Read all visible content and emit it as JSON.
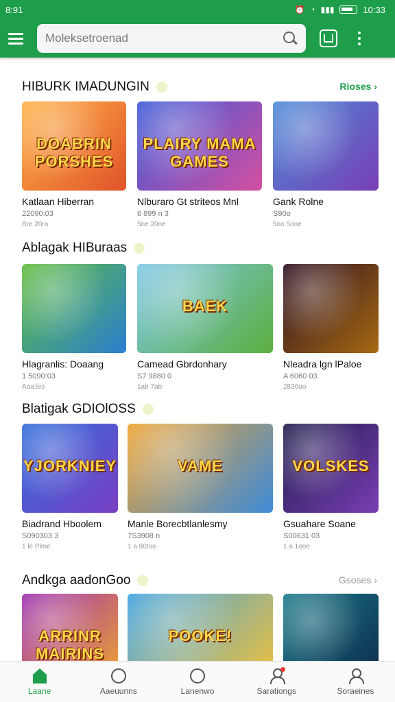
{
  "status_bar": {
    "time": "8:91",
    "right_time": "10:33"
  },
  "search": {
    "placeholder": "Moleksetroenad"
  },
  "sections": [
    {
      "title": "HIBURK IMADUNGIN",
      "more": "Rioses",
      "cards": [
        {
          "art": "DOABRIN PORSHES",
          "title": "Katlaan Hiberran",
          "sub1": "22090:03",
          "sub2": "Bre 20ra",
          "colors": [
            "#ffb347",
            "#e0542a"
          ]
        },
        {
          "art": "PLAIRY MAMA GAMES",
          "title": "Nlburaro Gt striteos Mnl",
          "sub1": "6 899 n 3",
          "sub2": "5ne 20ne",
          "colors": [
            "#3a59d8",
            "#d54fa0"
          ]
        },
        {
          "art": "",
          "title": "Gank Rolne",
          "sub1": "S90o",
          "sub2": "5no 5one",
          "colors": [
            "#4a8ad6",
            "#7a3fb5"
          ]
        }
      ]
    },
    {
      "title": "Ablagak HIBuraas",
      "more": "",
      "cards": [
        {
          "art": "",
          "title": "Hlagranlis: Doaang",
          "sub1": "1 5090:03",
          "sub2": "Aaa:les",
          "colors": [
            "#5fbd3c",
            "#2b7fd1"
          ]
        },
        {
          "art": "BAEK",
          "title": "Camead Gbrdonhary",
          "sub1": "S7 9880 0",
          "sub2": "1ab 7ab",
          "colors": [
            "#7ec8e8",
            "#5cae3f"
          ]
        },
        {
          "art": "",
          "title": "Nleadra lgn lPaloe",
          "sub1": "A 6060 03",
          "sub2": "2830oo",
          "colors": [
            "#2b0d20",
            "#a66a12"
          ]
        }
      ]
    },
    {
      "title": "Blatigak GDIOlOSS",
      "more": "",
      "cards": [
        {
          "art": "YJORKNIEY",
          "title": "Biadrand Hboolem",
          "sub1": "S090303 3",
          "sub2": "1 le Plme",
          "colors": [
            "#2f6ddb",
            "#7b3fc4"
          ]
        },
        {
          "art": "VAME",
          "title": "Manle Borecbtlanlesmy",
          "sub1": "7S3908 n",
          "sub2": "1 a 80toe",
          "colors": [
            "#f0a430",
            "#3d8bd9"
          ]
        },
        {
          "art": "VOLSKES",
          "title": "Gsuahare Soane",
          "sub1": "S00631 03",
          "sub2": "1 a 1ooe",
          "colors": [
            "#1d1b4a",
            "#7a3fb5"
          ]
        }
      ]
    },
    {
      "title": "Andkga aadonGoo",
      "more": "Gsoses",
      "cards": [
        {
          "art": "ARRINR MAIRINS",
          "title": "",
          "sub1": "",
          "sub2": "",
          "colors": [
            "#9c2fb0",
            "#f0a430"
          ]
        },
        {
          "art": "POOKE!",
          "title": "",
          "sub1": "",
          "sub2": "",
          "colors": [
            "#3fa3e0",
            "#f2c13a"
          ]
        },
        {
          "art": "",
          "title": "",
          "sub1": "",
          "sub2": "",
          "colors": [
            "#1a7a8a",
            "#0d2a4a"
          ]
        }
      ]
    }
  ],
  "bottom_nav": [
    {
      "label": "Laane",
      "icon": "home-icon",
      "active": true
    },
    {
      "label": "Aaeuunns",
      "icon": "gamepad-icon",
      "active": false
    },
    {
      "label": "Lanenwo",
      "icon": "search-icon",
      "active": false
    },
    {
      "label": "Sarationgs",
      "icon": "user-icon",
      "active": false
    },
    {
      "label": "Soraeines",
      "icon": "profile-icon",
      "active": false
    }
  ],
  "theme": {
    "primary": "#1e9e4a"
  }
}
